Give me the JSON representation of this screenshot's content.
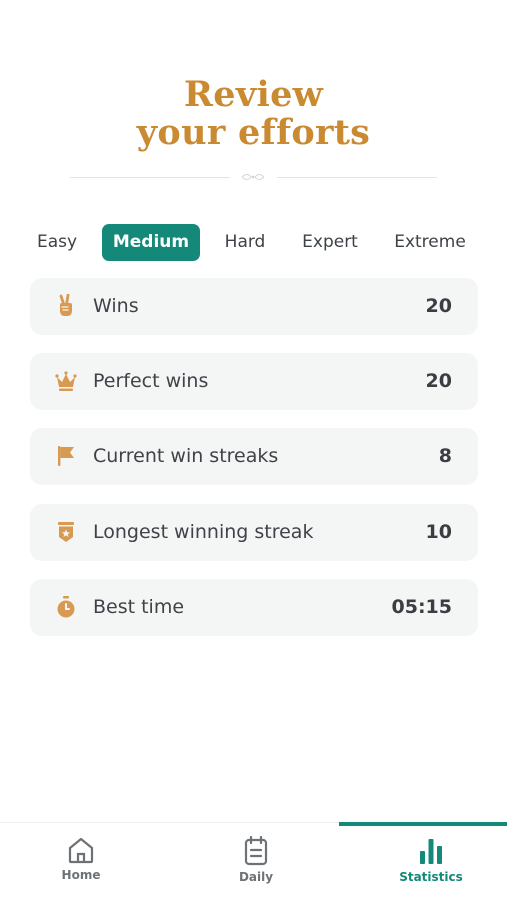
{
  "header": {
    "title_line1": "Review",
    "title_line2": "your efforts"
  },
  "tabs": [
    {
      "label": "Easy",
      "active": false
    },
    {
      "label": "Medium",
      "active": true
    },
    {
      "label": "Hard",
      "active": false
    },
    {
      "label": "Expert",
      "active": false
    },
    {
      "label": "Extreme",
      "active": false
    }
  ],
  "stats": [
    {
      "label": "Wins",
      "value": "20",
      "icon": "victory-hand-icon"
    },
    {
      "label": "Perfect wins",
      "value": "20",
      "icon": "crown-icon"
    },
    {
      "label": "Current win streaks",
      "value": "8",
      "icon": "flag-icon"
    },
    {
      "label": "Longest winning streak",
      "value": "10",
      "icon": "badge-star-icon"
    },
    {
      "label": "Best time",
      "value": "05:15",
      "icon": "stopwatch-icon"
    }
  ],
  "nav": {
    "items": [
      {
        "label": "Home",
        "icon": "home-icon",
        "active": false
      },
      {
        "label": "Daily",
        "icon": "calendar-icon",
        "active": false
      },
      {
        "label": "Statistics",
        "icon": "bar-chart-icon",
        "active": true
      }
    ]
  },
  "colors": {
    "accent": "#14897a",
    "title": "#c98a32",
    "icon": "#d89a52",
    "card": "#f4f5f5"
  }
}
